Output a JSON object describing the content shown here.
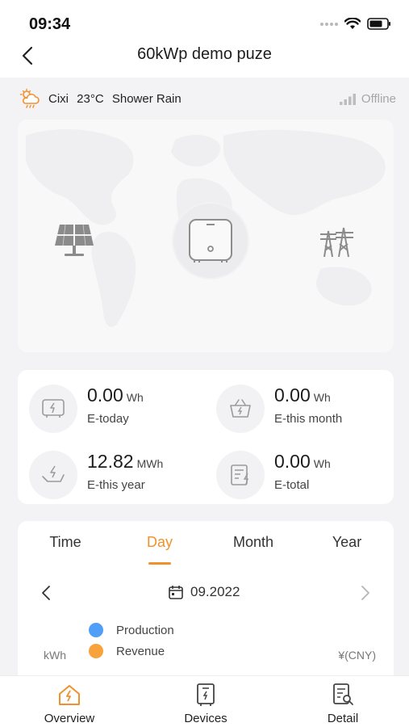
{
  "status_bar": {
    "time": "09:34"
  },
  "nav": {
    "title": "60kWp demo puze"
  },
  "weather": {
    "city": "Cixi",
    "temperature": "23°C",
    "condition": "Shower Rain",
    "connection_status": "Offline"
  },
  "flow": {
    "source_icon": "solar-panel-icon",
    "device_icon": "inverter-icon",
    "grid_icon": "power-tower-icon"
  },
  "stats": [
    {
      "value": "0.00",
      "unit": "Wh",
      "label": "E-today",
      "icon": "inverter-energy-icon"
    },
    {
      "value": "0.00",
      "unit": "Wh",
      "label": "E-this month",
      "icon": "basket-energy-icon"
    },
    {
      "value": "12.82",
      "unit": "MWh",
      "label": "E-this year",
      "icon": "hand-energy-icon"
    },
    {
      "value": "0.00",
      "unit": "Wh",
      "label": "E-total",
      "icon": "report-energy-icon"
    }
  ],
  "chart": {
    "tabs": [
      "Time",
      "Day",
      "Month",
      "Year"
    ],
    "active_tab": "Day",
    "date": "09.2022",
    "legend": [
      {
        "name": "Production",
        "color": "#4f9ef8"
      },
      {
        "name": "Revenue",
        "color": "#f7a23b"
      }
    ],
    "left_axis_unit": "kWh",
    "right_axis_unit": "¥(CNY)"
  },
  "bottom_nav": [
    {
      "label": "Overview",
      "icon": "home-energy-icon",
      "active": true
    },
    {
      "label": "Devices",
      "icon": "device-icon",
      "active": false
    },
    {
      "label": "Detail",
      "icon": "detail-doc-icon",
      "active": false
    }
  ],
  "colors": {
    "accent": "#f0912e",
    "offline": "#a6a6a6",
    "background": "#f3f3f5"
  }
}
